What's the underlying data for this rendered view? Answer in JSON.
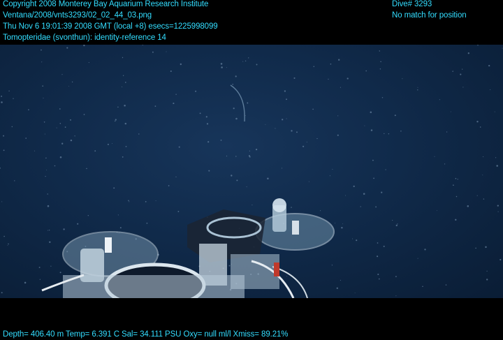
{
  "overlay": {
    "copyright": "Copyright 2008 Monterey Bay Aquarium Research Institute",
    "image_path": "Ventana/2008/vnts3293/02_02_44_03.png",
    "timestamp": "Thu Nov  6 19:01:39 2008 GMT (local +8)  esecs=1225998099",
    "annotation": "Tomopteridae (svonthun): identity-reference 14",
    "dive": "Dive# 3293",
    "position_status": "No match for position",
    "sensors": "Depth= 406.40 m  Temp= 6.391 C  Sal= 34.111 PSU  Oxy= null ml/l  Xmiss= 89.21%"
  },
  "scene": {
    "description_icon": "rov-sampler-equipment",
    "water_color": "#102a4a",
    "text_color": "#33ddff"
  }
}
